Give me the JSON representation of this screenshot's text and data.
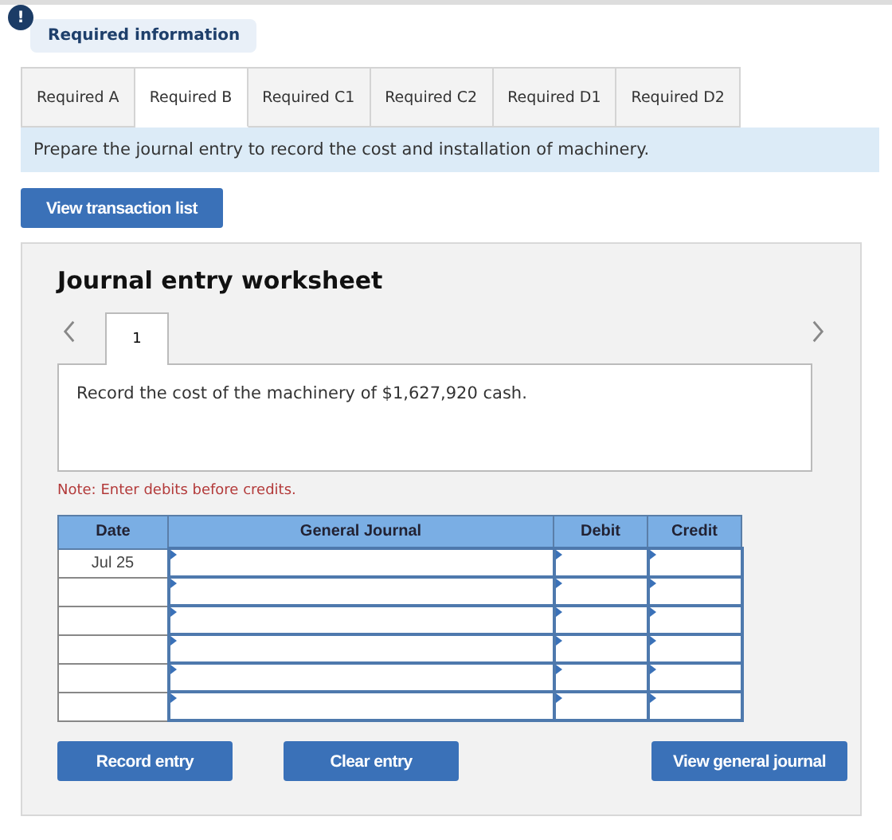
{
  "alert": {
    "symbol": "!",
    "label": "Required information"
  },
  "tabs": [
    {
      "label": "Required A",
      "selected": false
    },
    {
      "label": "Required B",
      "selected": true
    },
    {
      "label": "Required C1",
      "selected": false
    },
    {
      "label": "Required C2",
      "selected": false
    },
    {
      "label": "Required D1",
      "selected": false
    },
    {
      "label": "Required D2",
      "selected": false
    }
  ],
  "instruction": "Prepare the journal entry to record the cost and installation of machinery.",
  "view_transaction_button": "View transaction list",
  "worksheet": {
    "title": "Journal entry worksheet",
    "entries": [
      {
        "label": "1",
        "selected": true
      }
    ],
    "description": "Record the cost of the machinery of $1,627,920 cash.",
    "note": "Note: Enter debits before credits.",
    "columns": [
      "Date",
      "General Journal",
      "Debit",
      "Credit"
    ],
    "rows": [
      {
        "date": "Jul 25"
      },
      {},
      {},
      {},
      {},
      {}
    ],
    "buttons": [
      "Record entry",
      "Clear entry",
      "View general journal"
    ]
  }
}
